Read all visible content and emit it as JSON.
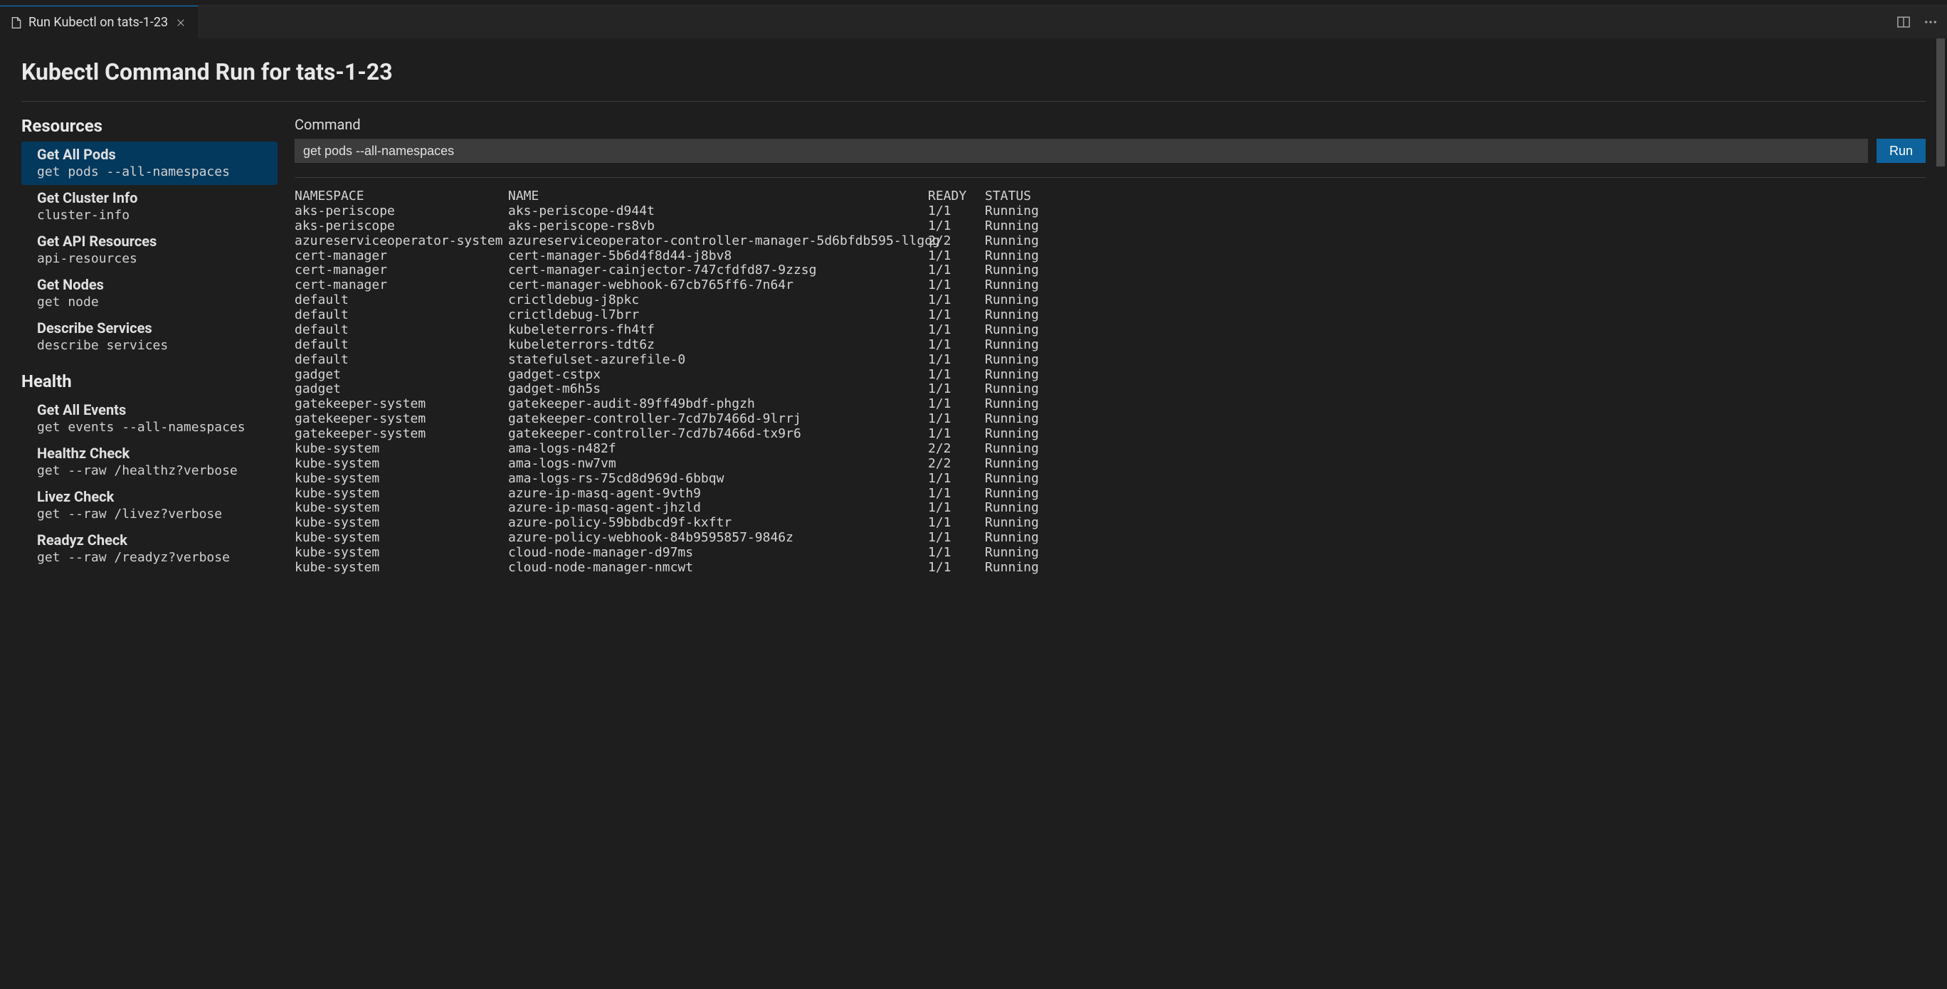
{
  "tab": {
    "title": "Run Kubectl on tats-1-23"
  },
  "header": {
    "title": "Kubectl Command Run for tats-1-23"
  },
  "sidebar": {
    "sections": [
      {
        "title": "Resources",
        "items": [
          {
            "label": "Get All Pods",
            "cmd": "get pods --all-namespaces",
            "selected": true
          },
          {
            "label": "Get Cluster Info",
            "cmd": "cluster-info",
            "selected": false
          },
          {
            "label": "Get API Resources",
            "cmd": "api-resources",
            "selected": false
          },
          {
            "label": "Get Nodes",
            "cmd": "get node",
            "selected": false
          },
          {
            "label": "Describe Services",
            "cmd": "describe services",
            "selected": false
          }
        ]
      },
      {
        "title": "Health",
        "items": [
          {
            "label": "Get All Events",
            "cmd": "get events --all-namespaces",
            "selected": false
          },
          {
            "label": "Healthz Check",
            "cmd": "get --raw /healthz?verbose",
            "selected": false
          },
          {
            "label": "Livez Check",
            "cmd": "get --raw /livez?verbose",
            "selected": false
          },
          {
            "label": "Readyz Check",
            "cmd": "get --raw /readyz?verbose",
            "selected": false
          }
        ]
      }
    ]
  },
  "command": {
    "label": "Command",
    "value": "get pods --all-namespaces",
    "run_label": "Run"
  },
  "output": {
    "headers": {
      "namespace": "NAMESPACE",
      "name": "NAME",
      "ready": "READY",
      "status": "STATUS"
    },
    "rows": [
      {
        "ns": "aks-periscope",
        "name": "aks-periscope-d944t",
        "ready": "1/1",
        "status": "Running"
      },
      {
        "ns": "aks-periscope",
        "name": "aks-periscope-rs8vb",
        "ready": "1/1",
        "status": "Running"
      },
      {
        "ns": "azureserviceoperator-system",
        "name": "azureserviceoperator-controller-manager-5d6bfdb595-llgqg",
        "ready": "2/2",
        "status": "Running"
      },
      {
        "ns": "cert-manager",
        "name": "cert-manager-5b6d4f8d44-j8bv8",
        "ready": "1/1",
        "status": "Running"
      },
      {
        "ns": "cert-manager",
        "name": "cert-manager-cainjector-747cfdfd87-9zzsg",
        "ready": "1/1",
        "status": "Running"
      },
      {
        "ns": "cert-manager",
        "name": "cert-manager-webhook-67cb765ff6-7n64r",
        "ready": "1/1",
        "status": "Running"
      },
      {
        "ns": "default",
        "name": "crictldebug-j8pkc",
        "ready": "1/1",
        "status": "Running"
      },
      {
        "ns": "default",
        "name": "crictldebug-l7brr",
        "ready": "1/1",
        "status": "Running"
      },
      {
        "ns": "default",
        "name": "kubeleterrors-fh4tf",
        "ready": "1/1",
        "status": "Running"
      },
      {
        "ns": "default",
        "name": "kubeleterrors-tdt6z",
        "ready": "1/1",
        "status": "Running"
      },
      {
        "ns": "default",
        "name": "statefulset-azurefile-0",
        "ready": "1/1",
        "status": "Running"
      },
      {
        "ns": "gadget",
        "name": "gadget-cstpx",
        "ready": "1/1",
        "status": "Running"
      },
      {
        "ns": "gadget",
        "name": "gadget-m6h5s",
        "ready": "1/1",
        "status": "Running"
      },
      {
        "ns": "gatekeeper-system",
        "name": "gatekeeper-audit-89ff49bdf-phgzh",
        "ready": "1/1",
        "status": "Running"
      },
      {
        "ns": "gatekeeper-system",
        "name": "gatekeeper-controller-7cd7b7466d-9lrrj",
        "ready": "1/1",
        "status": "Running"
      },
      {
        "ns": "gatekeeper-system",
        "name": "gatekeeper-controller-7cd7b7466d-tx9r6",
        "ready": "1/1",
        "status": "Running"
      },
      {
        "ns": "kube-system",
        "name": "ama-logs-n482f",
        "ready": "2/2",
        "status": "Running"
      },
      {
        "ns": "kube-system",
        "name": "ama-logs-nw7vm",
        "ready": "2/2",
        "status": "Running"
      },
      {
        "ns": "kube-system",
        "name": "ama-logs-rs-75cd8d969d-6bbqw",
        "ready": "1/1",
        "status": "Running"
      },
      {
        "ns": "kube-system",
        "name": "azure-ip-masq-agent-9vth9",
        "ready": "1/1",
        "status": "Running"
      },
      {
        "ns": "kube-system",
        "name": "azure-ip-masq-agent-jhzld",
        "ready": "1/1",
        "status": "Running"
      },
      {
        "ns": "kube-system",
        "name": "azure-policy-59bbdbcd9f-kxftr",
        "ready": "1/1",
        "status": "Running"
      },
      {
        "ns": "kube-system",
        "name": "azure-policy-webhook-84b9595857-9846z",
        "ready": "1/1",
        "status": "Running"
      },
      {
        "ns": "kube-system",
        "name": "cloud-node-manager-d97ms",
        "ready": "1/1",
        "status": "Running"
      },
      {
        "ns": "kube-system",
        "name": "cloud-node-manager-nmcwt",
        "ready": "1/1",
        "status": "Running"
      }
    ]
  }
}
